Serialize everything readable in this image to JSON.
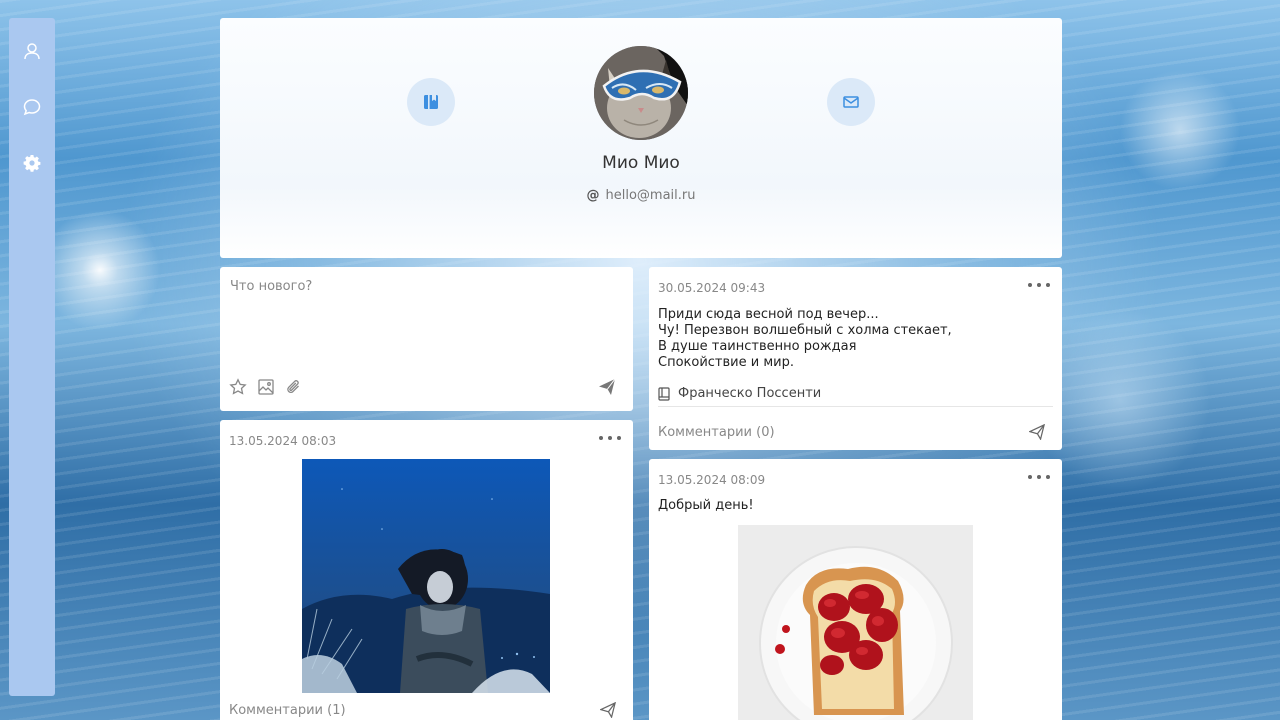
{
  "sidebar": {
    "items": [
      {
        "icon": "user-icon"
      },
      {
        "icon": "chat-icon"
      },
      {
        "icon": "gear-icon"
      }
    ]
  },
  "profile": {
    "name": "Мио Мио",
    "email": "hello@mail.ru",
    "at_symbol": "@"
  },
  "composer": {
    "placeholder": "Что нового?"
  },
  "posts": [
    {
      "date": "13.05.2024 08:03",
      "comments": "Комментарии (1)"
    },
    {
      "date": "30.05.2024 09:43",
      "lines": [
        "Приди сюда весной под вечер...",
        "Чу! Перезвон волшебный с холма стекает,",
        "В душе таинственно рождая",
        "Спокойствие и мир."
      ],
      "author": "Франческо Поссенти",
      "comments": "Комментарии (0)"
    },
    {
      "date": "13.05.2024 08:09",
      "text": "Добрый день!"
    }
  ],
  "colors": {
    "accent": "#3d8fe0",
    "sidebar_bg": "#aac8f0",
    "circle_bg": "#dbe9f8"
  }
}
